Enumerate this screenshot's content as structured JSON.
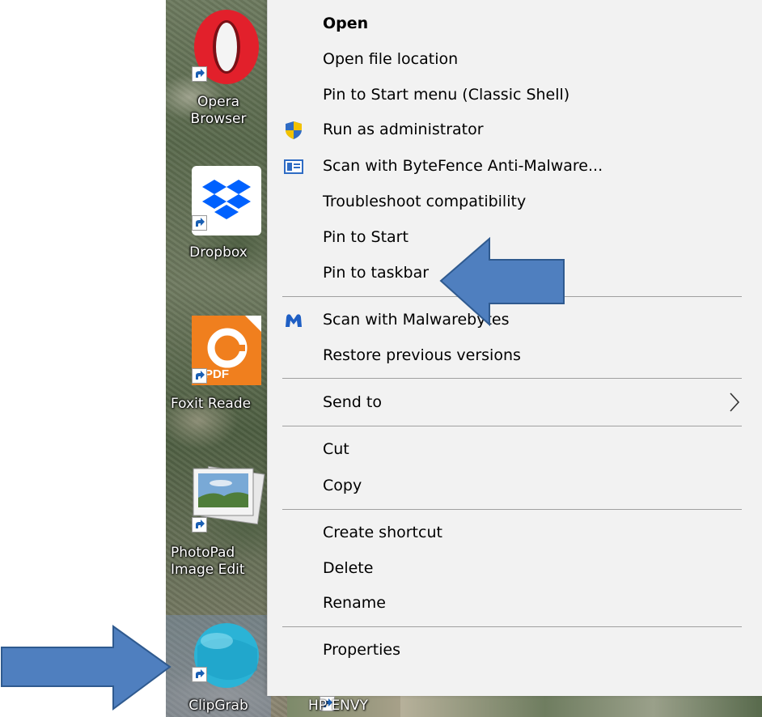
{
  "desktop": {
    "icons": [
      {
        "name": "Opera Browser",
        "line1": "Opera",
        "line2": "Browser"
      },
      {
        "name": "Dropbox",
        "line1": "Dropbox"
      },
      {
        "name": "Foxit Reader",
        "line1": "Foxit Reade",
        "badge": "PDF"
      },
      {
        "name": "PhotoPad Image Editor",
        "line1": "PhotoPad",
        "line2": "Image Edit"
      },
      {
        "name": "ClipGrab",
        "line1": "ClipGrab"
      },
      {
        "name": "HP ENVY",
        "line1": "HP ENVY"
      }
    ]
  },
  "menu": {
    "items": [
      {
        "label": "Open",
        "bold": true
      },
      {
        "label": "Open file location"
      },
      {
        "label": "Pin to Start menu (Classic Shell)"
      },
      {
        "label": "Run as administrator",
        "icon": "uac-shield-icon"
      },
      {
        "label": "Scan with ByteFence Anti-Malware...",
        "icon": "bytefence-icon"
      },
      {
        "label": "Troubleshoot compatibility"
      },
      {
        "label": "Pin to Start"
      },
      {
        "label": "Pin to taskbar"
      },
      {
        "label": "Scan with Malwarebytes",
        "icon": "malwarebytes-icon"
      },
      {
        "label": "Restore previous versions"
      },
      {
        "label": "Send to",
        "submenu": true
      },
      {
        "label": "Cut"
      },
      {
        "label": "Copy"
      },
      {
        "label": "Create shortcut"
      },
      {
        "label": "Delete"
      },
      {
        "label": "Rename"
      },
      {
        "label": "Properties"
      }
    ]
  },
  "colors": {
    "menu_bg": "#f2f2f2",
    "arrow_fill": "#4f7fbf",
    "arrow_stroke": "#2f5a8f"
  }
}
